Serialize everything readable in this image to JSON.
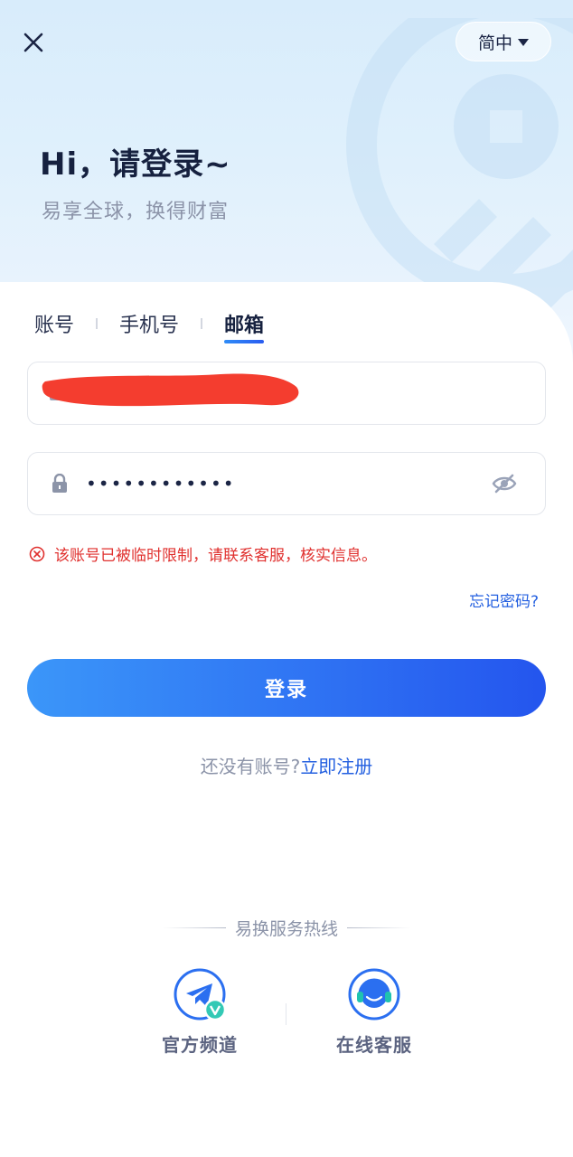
{
  "header": {
    "lang_label": "简中",
    "greeting": "Hi，请登录~",
    "slogan": "易享全球，换得财富"
  },
  "tabs": [
    {
      "label": "账号",
      "active": false
    },
    {
      "label": "手机号",
      "active": false
    },
    {
      "label": "邮箱",
      "active": true
    }
  ],
  "form": {
    "email_value": "",
    "password_value": "••••••••••••"
  },
  "error": {
    "message": "该账号已被临时限制，请联系客服，核实信息。"
  },
  "forgot_label": "忘记密码?",
  "login_label": "登录",
  "register": {
    "prompt": "还没有账号?",
    "link": "立即注册"
  },
  "hotline": {
    "title": "易换服务热线"
  },
  "services": [
    {
      "label": "官方频道",
      "icon": "telegram-icon"
    },
    {
      "label": "在线客服",
      "icon": "headset-icon"
    }
  ],
  "colors": {
    "accent": "#2460e0",
    "button_start": "#3b96f9",
    "button_end": "#2455ee",
    "error": "#e0302e",
    "redaction": "#f43d2f"
  }
}
